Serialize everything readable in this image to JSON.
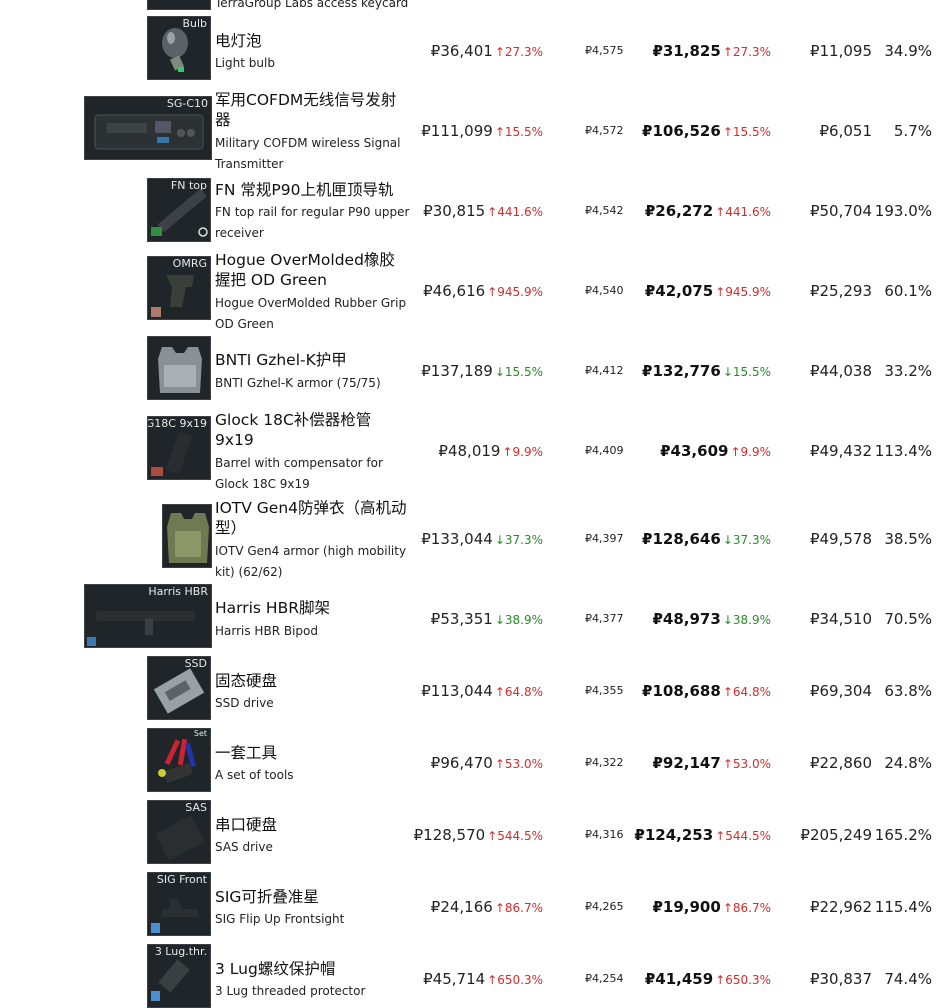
{
  "top_partial": {
    "name_en": "TerraGroup Labs access keycard"
  },
  "rows": [
    {
      "tag": "Bulb",
      "name_cn": "电灯泡",
      "name_en": "Light bulb",
      "price": "₽36,401",
      "price_pct": "↑27.3%",
      "dir": "up",
      "fee": "₽4,575",
      "net": "₽31,825",
      "net_pct": "↑27.3%",
      "profit": "₽11,095",
      "margin": "34.9%"
    },
    {
      "tag": "SG-C10",
      "name_cn": "军用COFDM无线信号发射器",
      "name_en": "Military COFDM wireless Signal Transmitter",
      "price": "₽111,099",
      "price_pct": "↑15.5%",
      "dir": "up",
      "fee": "₽4,572",
      "net": "₽106,526",
      "net_pct": "↑15.5%",
      "profit": "₽6,051",
      "margin": "5.7%"
    },
    {
      "tag": "FN top",
      "name_cn": "FN 常规P90上机匣顶导轨",
      "name_en": "FN top rail for regular P90 upper receiver",
      "price": "₽30,815",
      "price_pct": "↑441.6%",
      "dir": "up",
      "fee": "₽4,542",
      "net": "₽26,272",
      "net_pct": "↑441.6%",
      "profit": "₽50,704",
      "margin": "193.0%"
    },
    {
      "tag": "OMRG",
      "name_cn": "Hogue OverMolded橡胶握把 OD Green",
      "name_en": "Hogue OverMolded Rubber Grip OD Green",
      "price": "₽46,616",
      "price_pct": "↑945.9%",
      "dir": "up",
      "fee": "₽4,540",
      "net": "₽42,075",
      "net_pct": "↑945.9%",
      "profit": "₽25,293",
      "margin": "60.1%"
    },
    {
      "tag": "",
      "name_cn": "BNTI Gzhel-K护甲",
      "name_en": "BNTI Gzhel-K armor (75/75)",
      "price": "₽137,189",
      "price_pct": "↓15.5%",
      "dir": "down",
      "fee": "₽4,412",
      "net": "₽132,776",
      "net_pct": "↓15.5%",
      "profit": "₽44,038",
      "margin": "33.2%"
    },
    {
      "tag": "G18C 9x19",
      "name_cn": "Glock 18C补偿器枪管 9x19",
      "name_en": "Barrel with compensator for Glock 18C 9x19",
      "price": "₽48,019",
      "price_pct": "↑9.9%",
      "dir": "up",
      "fee": "₽4,409",
      "net": "₽43,609",
      "net_pct": "↑9.9%",
      "profit": "₽49,432",
      "margin": "113.4%"
    },
    {
      "tag": "",
      "name_cn": "IOTV Gen4防弹衣（高机动型）",
      "name_en": "IOTV Gen4 armor (high mobility kit) (62/62)",
      "price": "₽133,044",
      "price_pct": "↓37.3%",
      "dir": "down",
      "fee": "₽4,397",
      "net": "₽128,646",
      "net_pct": "↓37.3%",
      "profit": "₽49,578",
      "margin": "38.5%"
    },
    {
      "tag": "Harris HBR",
      "name_cn": "Harris HBR脚架",
      "name_en": "Harris HBR Bipod",
      "price": "₽53,351",
      "price_pct": "↓38.9%",
      "dir": "down",
      "fee": "₽4,377",
      "net": "₽48,973",
      "net_pct": "↓38.9%",
      "profit": "₽34,510",
      "margin": "70.5%"
    },
    {
      "tag": "SSD",
      "name_cn": "固态硬盘",
      "name_en": "SSD drive",
      "price": "₽113,044",
      "price_pct": "↑64.8%",
      "dir": "up",
      "fee": "₽4,355",
      "net": "₽108,688",
      "net_pct": "↑64.8%",
      "profit": "₽69,304",
      "margin": "63.8%"
    },
    {
      "tag": "Set",
      "name_cn": "一套工具",
      "name_en": "A set of tools",
      "price": "₽96,470",
      "price_pct": "↑53.0%",
      "dir": "up",
      "fee": "₽4,322",
      "net": "₽92,147",
      "net_pct": "↑53.0%",
      "profit": "₽22,860",
      "margin": "24.8%"
    },
    {
      "tag": "SAS",
      "name_cn": "串口硬盘",
      "name_en": "SAS drive",
      "price": "₽128,570",
      "price_pct": "↑544.5%",
      "dir": "up",
      "fee": "₽4,316",
      "net": "₽124,253",
      "net_pct": "↑544.5%",
      "profit": "₽205,249",
      "margin": "165.2%"
    },
    {
      "tag": "SIG Front",
      "name_cn": "SIG可折叠准星",
      "name_en": "SIG Flip Up Frontsight",
      "price": "₽24,166",
      "price_pct": "↑86.7%",
      "dir": "up",
      "fee": "₽4,265",
      "net": "₽19,900",
      "net_pct": "↑86.7%",
      "profit": "₽22,962",
      "margin": "115.4%"
    },
    {
      "tag": "3 Lug.thr.",
      "name_cn": "3 Lug螺纹保护帽",
      "name_en": "3 Lug threaded protector",
      "price": "₽45,714",
      "price_pct": "↑650.3%",
      "dir": "up",
      "fee": "₽4,254",
      "net": "₽41,459",
      "net_pct": "↑650.3%",
      "profit": "₽30,837",
      "margin": "74.4%"
    }
  ]
}
